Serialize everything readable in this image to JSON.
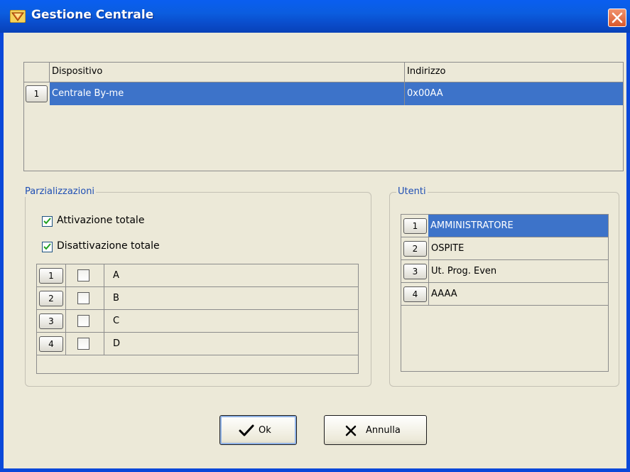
{
  "window": {
    "title": "Gestione Centrale",
    "icon": "app-shield-icon",
    "close_icon": "close-icon"
  },
  "devices": {
    "columns": [
      "Dispositivo",
      "Indirizzo"
    ],
    "rows": [
      {
        "index": "1",
        "device": "Centrale By-me",
        "address": "0x00AA",
        "selected": true
      }
    ]
  },
  "partitions": {
    "label": "Parzializzazioni",
    "total_activation": {
      "label": "Attivazione totale",
      "checked": true
    },
    "total_deactivation": {
      "label": "Disattivazione totale",
      "checked": true
    },
    "rows": [
      {
        "index": "1",
        "name": "A",
        "checked": false
      },
      {
        "index": "2",
        "name": "B",
        "checked": false
      },
      {
        "index": "3",
        "name": "C",
        "checked": false
      },
      {
        "index": "4",
        "name": "D",
        "checked": false
      }
    ]
  },
  "users": {
    "label": "Utenti",
    "rows": [
      {
        "index": "1",
        "name": "AMMINISTRATORE",
        "selected": true
      },
      {
        "index": "2",
        "name": "OSPITE",
        "selected": false
      },
      {
        "index": "3",
        "name": "Ut. Prog. Even",
        "selected": false
      },
      {
        "index": "4",
        "name": "AAAA",
        "selected": false
      }
    ]
  },
  "buttons": {
    "ok": "Ok",
    "cancel": "Annulla",
    "ok_icon": "checkmark-icon",
    "cancel_icon": "x-icon"
  },
  "colors": {
    "titlebar": "#0a5ef0",
    "selection": "#3d73c9",
    "group_label": "#1f4fb4",
    "dialog_bg": "#ece9d8"
  }
}
